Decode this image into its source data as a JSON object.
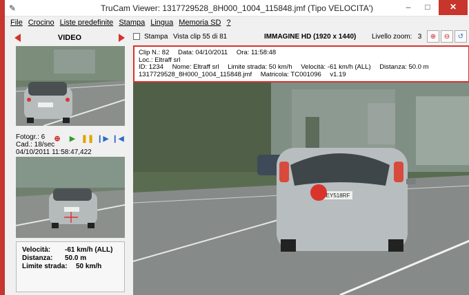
{
  "window": {
    "title": "TruCam Viewer:   1317729528_8H000_1004_115848.jmf   (Tipo VELOCITA')",
    "controls": {
      "minimize": "–",
      "maximize": "□",
      "close": "✕"
    }
  },
  "menu": {
    "items": [
      "File",
      "Crocino",
      "Liste predefinite",
      "Stampa",
      "Lingua",
      "Memoria SD",
      "?"
    ]
  },
  "left": {
    "video_label": "VIDEO",
    "frame_info": {
      "fotogr": "Fotogr.: 6",
      "cad": "Cad.: 18/sec",
      "datetime": "04/10/2011 11:58:47,422"
    },
    "measure": {
      "rows": [
        {
          "key": "Velocità:",
          "value": "-61 km/h (ALL)"
        },
        {
          "key": "Distanza:",
          "value": "50.0 m"
        },
        {
          "key": "Limite strada:",
          "value": "50 km/h"
        }
      ]
    }
  },
  "topbar": {
    "stampa": "Stampa",
    "vista": "Vista clip 55 di 81",
    "immagine": "IMMAGINE HD (1920 x 1440)",
    "zoom_label": "Livello zoom:",
    "zoom_value": "3"
  },
  "clip": {
    "line1": {
      "clip": "Clip N.: 82",
      "date": "Data: 04/10/2011",
      "time": "Ora: 11:58:48"
    },
    "line2": "Loc.: Eltraff srl",
    "line3": {
      "id": "ID: 1234",
      "name": "Nome: Eltraff srl",
      "limit": "Limite strada: 50 km/h",
      "speed": "Velocità: -61 km/h (ALL)",
      "dist": "Distanza: 50.0 m"
    },
    "line4": {
      "file": "1317729528_8H000_1004_115848.jmf",
      "matricola": "Matricola: TC001096",
      "ver": "v1.19"
    }
  },
  "plate_text": "EY518RF",
  "colors": {
    "accent_red": "#d6322b",
    "play_green": "#2a9b2a",
    "pause_yellow": "#e0a400",
    "step_blue": "#2f6cc8"
  }
}
